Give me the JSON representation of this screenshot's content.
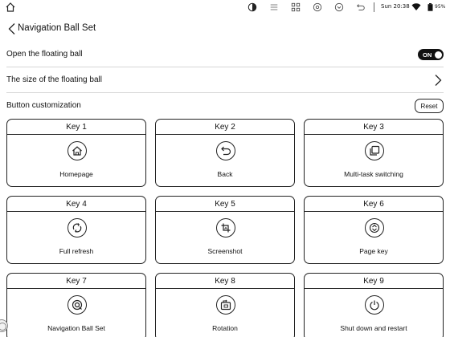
{
  "statusbar": {
    "time": "Sun 20:38",
    "battery": "95%",
    "icons": [
      "home-icon",
      "contrast-icon",
      "menu-icon",
      "apps-grid-icon",
      "settings-ring-icon",
      "chevron-circle-icon",
      "return-icon",
      "wifi-icon",
      "battery-icon"
    ]
  },
  "header": {
    "title": "Navigation Ball Set"
  },
  "rows": {
    "open_floating_ball": {
      "label": "Open the floating ball",
      "toggle_text": "ON",
      "toggle_state": true
    },
    "size_floating_ball": {
      "label": "The size of the floating ball"
    }
  },
  "section": {
    "label": "Button customization",
    "reset_label": "Reset"
  },
  "keys": [
    {
      "title": "Key 1",
      "label": "Homepage",
      "icon": "home-icon"
    },
    {
      "title": "Key 2",
      "label": "Back",
      "icon": "back-arrow-icon"
    },
    {
      "title": "Key 3",
      "label": "Multi-task switching",
      "icon": "multitask-icon"
    },
    {
      "title": "Key 4",
      "label": "Full refresh",
      "icon": "refresh-icon"
    },
    {
      "title": "Key 5",
      "label": "Screenshot",
      "icon": "screenshot-icon"
    },
    {
      "title": "Key 6",
      "label": "Page key",
      "icon": "page-updown-icon"
    },
    {
      "title": "Key 7",
      "label": "Navigation Ball Set",
      "icon": "navigation-ball-icon"
    },
    {
      "title": "Key 8",
      "label": "Rotation",
      "icon": "rotation-icon"
    },
    {
      "title": "Key 9",
      "label": "Shut down and restart",
      "icon": "power-icon"
    }
  ]
}
